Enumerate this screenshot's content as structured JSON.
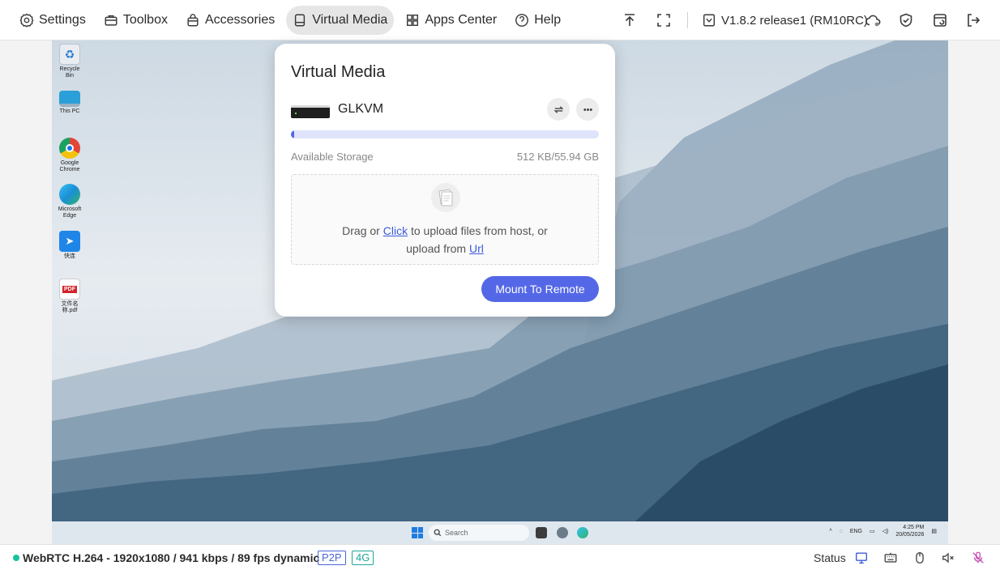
{
  "menu": {
    "items": [
      {
        "label": "Settings",
        "icon": "gear-icon"
      },
      {
        "label": "Toolbox",
        "icon": "toolbox-icon"
      },
      {
        "label": "Accessories",
        "icon": "bag-icon"
      },
      {
        "label": "Virtual Media",
        "icon": "drive-icon",
        "active": true
      },
      {
        "label": "Apps Center",
        "icon": "apps-grid-icon"
      },
      {
        "label": "Help",
        "icon": "help-icon"
      }
    ],
    "version": "V1.8.2 release1 (RM10RC)"
  },
  "desktop": {
    "icons": [
      {
        "label": "Recycle Bin",
        "icon": "recycle-bin-icon",
        "color": "#e9edf2"
      },
      {
        "label": "This PC",
        "icon": "monitor-icon",
        "color": "#2a9fd8"
      },
      {
        "label": "Google Chrome",
        "icon": "chrome-icon",
        "color": "#e0463a"
      },
      {
        "label": "Microsoft Edge",
        "icon": "edge-icon",
        "color": "#1b8fd6"
      },
      {
        "label": "快连",
        "icon": "app-icon",
        "color": "#1f86e8"
      },
      {
        "label": "文件名称.pdf",
        "icon": "pdf-icon",
        "color": "#d3232a"
      }
    ],
    "pdf_glyph": "PDF"
  },
  "taskbar": {
    "search_placeholder": "Search",
    "lang": "ENG",
    "time": "4:25 PM",
    "date": "20/05/2026"
  },
  "dialog": {
    "title": "Virtual Media",
    "drive_name": "GLKVM",
    "storage_label": "Available Storage",
    "storage_value": "512 KB/55.94 GB",
    "storage_used_fraction": 0.01,
    "drop_text_1": "Drag or ",
    "drop_link_click": "Click",
    "drop_text_2": " to upload files from host, or",
    "drop_text_3": "upload from ",
    "drop_link_url": "Url",
    "mount_button": "Mount To Remote"
  },
  "status": {
    "stream_info": "WebRTC H.264 - 1920x1080 /  941 kbps / 89 fps dynamic",
    "tag_p2p": "P2P",
    "tag_4g": "4G",
    "status_label": "Status",
    "dot_color": "#18c29c"
  }
}
